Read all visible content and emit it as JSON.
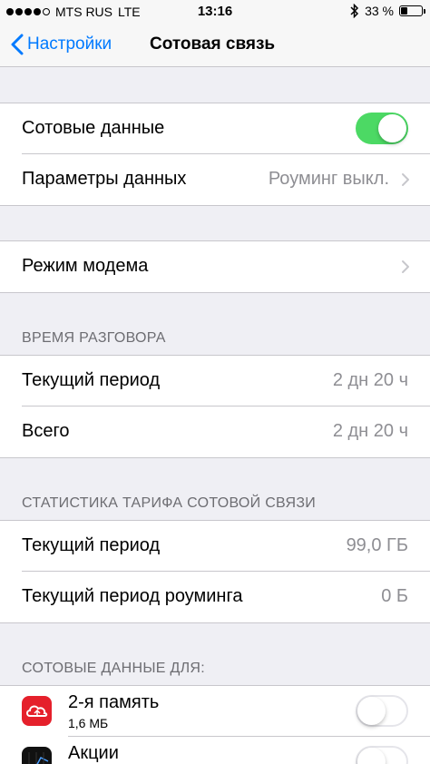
{
  "status_bar": {
    "carrier": "MTS RUS",
    "network": "LTE",
    "time": "13:16",
    "battery_percent": "33 %",
    "battery_level": 0.33,
    "signal_bars": 4
  },
  "nav": {
    "back_label": "Настройки",
    "title": "Сотовая связь"
  },
  "group1": {
    "cellular_data_label": "Сотовые данные",
    "cellular_data_on": true,
    "data_options_label": "Параметры данных",
    "data_options_value": "Роуминг выкл."
  },
  "group2": {
    "hotspot_label": "Режим модема"
  },
  "call_time": {
    "header": "ВРЕМЯ РАЗГОВОРА",
    "current_label": "Текущий период",
    "current_value": "2 дн 20 ч",
    "total_label": "Всего",
    "total_value": "2 дн 20 ч"
  },
  "stats": {
    "header": "СТАТИСТИКА ТАРИФА СОТОВОЙ СВЯЗИ",
    "current_label": "Текущий период",
    "current_value": "99,0 ГБ",
    "roaming_label": "Текущий период роуминга",
    "roaming_value": "0 Б"
  },
  "apps_section": {
    "header": "СОТОВЫЕ ДАННЫЕ ДЛЯ:",
    "apps": [
      {
        "name": "2-я память",
        "usage": "1,6 МБ",
        "icon": "cloud-storage-icon",
        "enabled": false
      },
      {
        "name": "Акции",
        "usage": "",
        "icon": "stocks-icon",
        "enabled": false
      }
    ]
  },
  "colors": {
    "accent": "#007aff",
    "switch_on": "#4cd964",
    "background": "#efeff4",
    "secondary_text": "#8e8e93",
    "app_icon_red": "#e5202b"
  }
}
